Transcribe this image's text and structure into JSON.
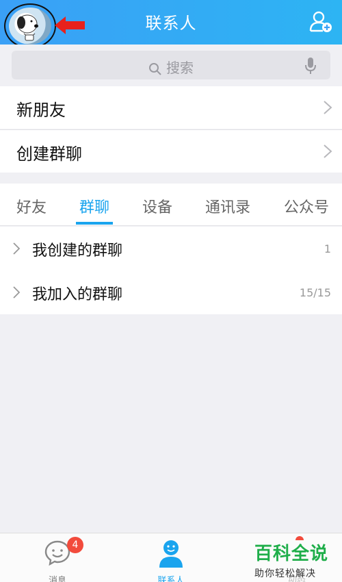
{
  "header": {
    "title": "联系人",
    "avatar_icon": "snoopy-avatar",
    "annotation_icon": "red-arrow",
    "add_icon": "add-friend-icon"
  },
  "search": {
    "placeholder": "搜索",
    "icon": "search-icon",
    "mic_icon": "microphone-icon"
  },
  "menu": {
    "items": [
      {
        "label": "新朋友"
      },
      {
        "label": "创建群聊"
      }
    ]
  },
  "tabs": {
    "items": [
      "好友",
      "群聊",
      "设备",
      "通讯录",
      "公众号"
    ],
    "active": "群聊"
  },
  "groups": {
    "items": [
      {
        "label": "我创建的群聊",
        "count": "1"
      },
      {
        "label": "我加入的群聊",
        "count": "15/15"
      }
    ]
  },
  "bottom_nav": {
    "items": [
      {
        "label": "消息",
        "icon": "message-icon",
        "badge": "4"
      },
      {
        "label": "联系人",
        "icon": "contacts-icon",
        "active": true
      },
      {
        "label": "动态",
        "icon": "star-icon"
      }
    ]
  },
  "watermark": {
    "main": "百科全说",
    "sub": "助你轻松解决"
  },
  "colors": {
    "accent": "#1aa4ee",
    "header": "#2db4f3",
    "badge": "#f24b3c",
    "watermark": "#1fae4a"
  }
}
